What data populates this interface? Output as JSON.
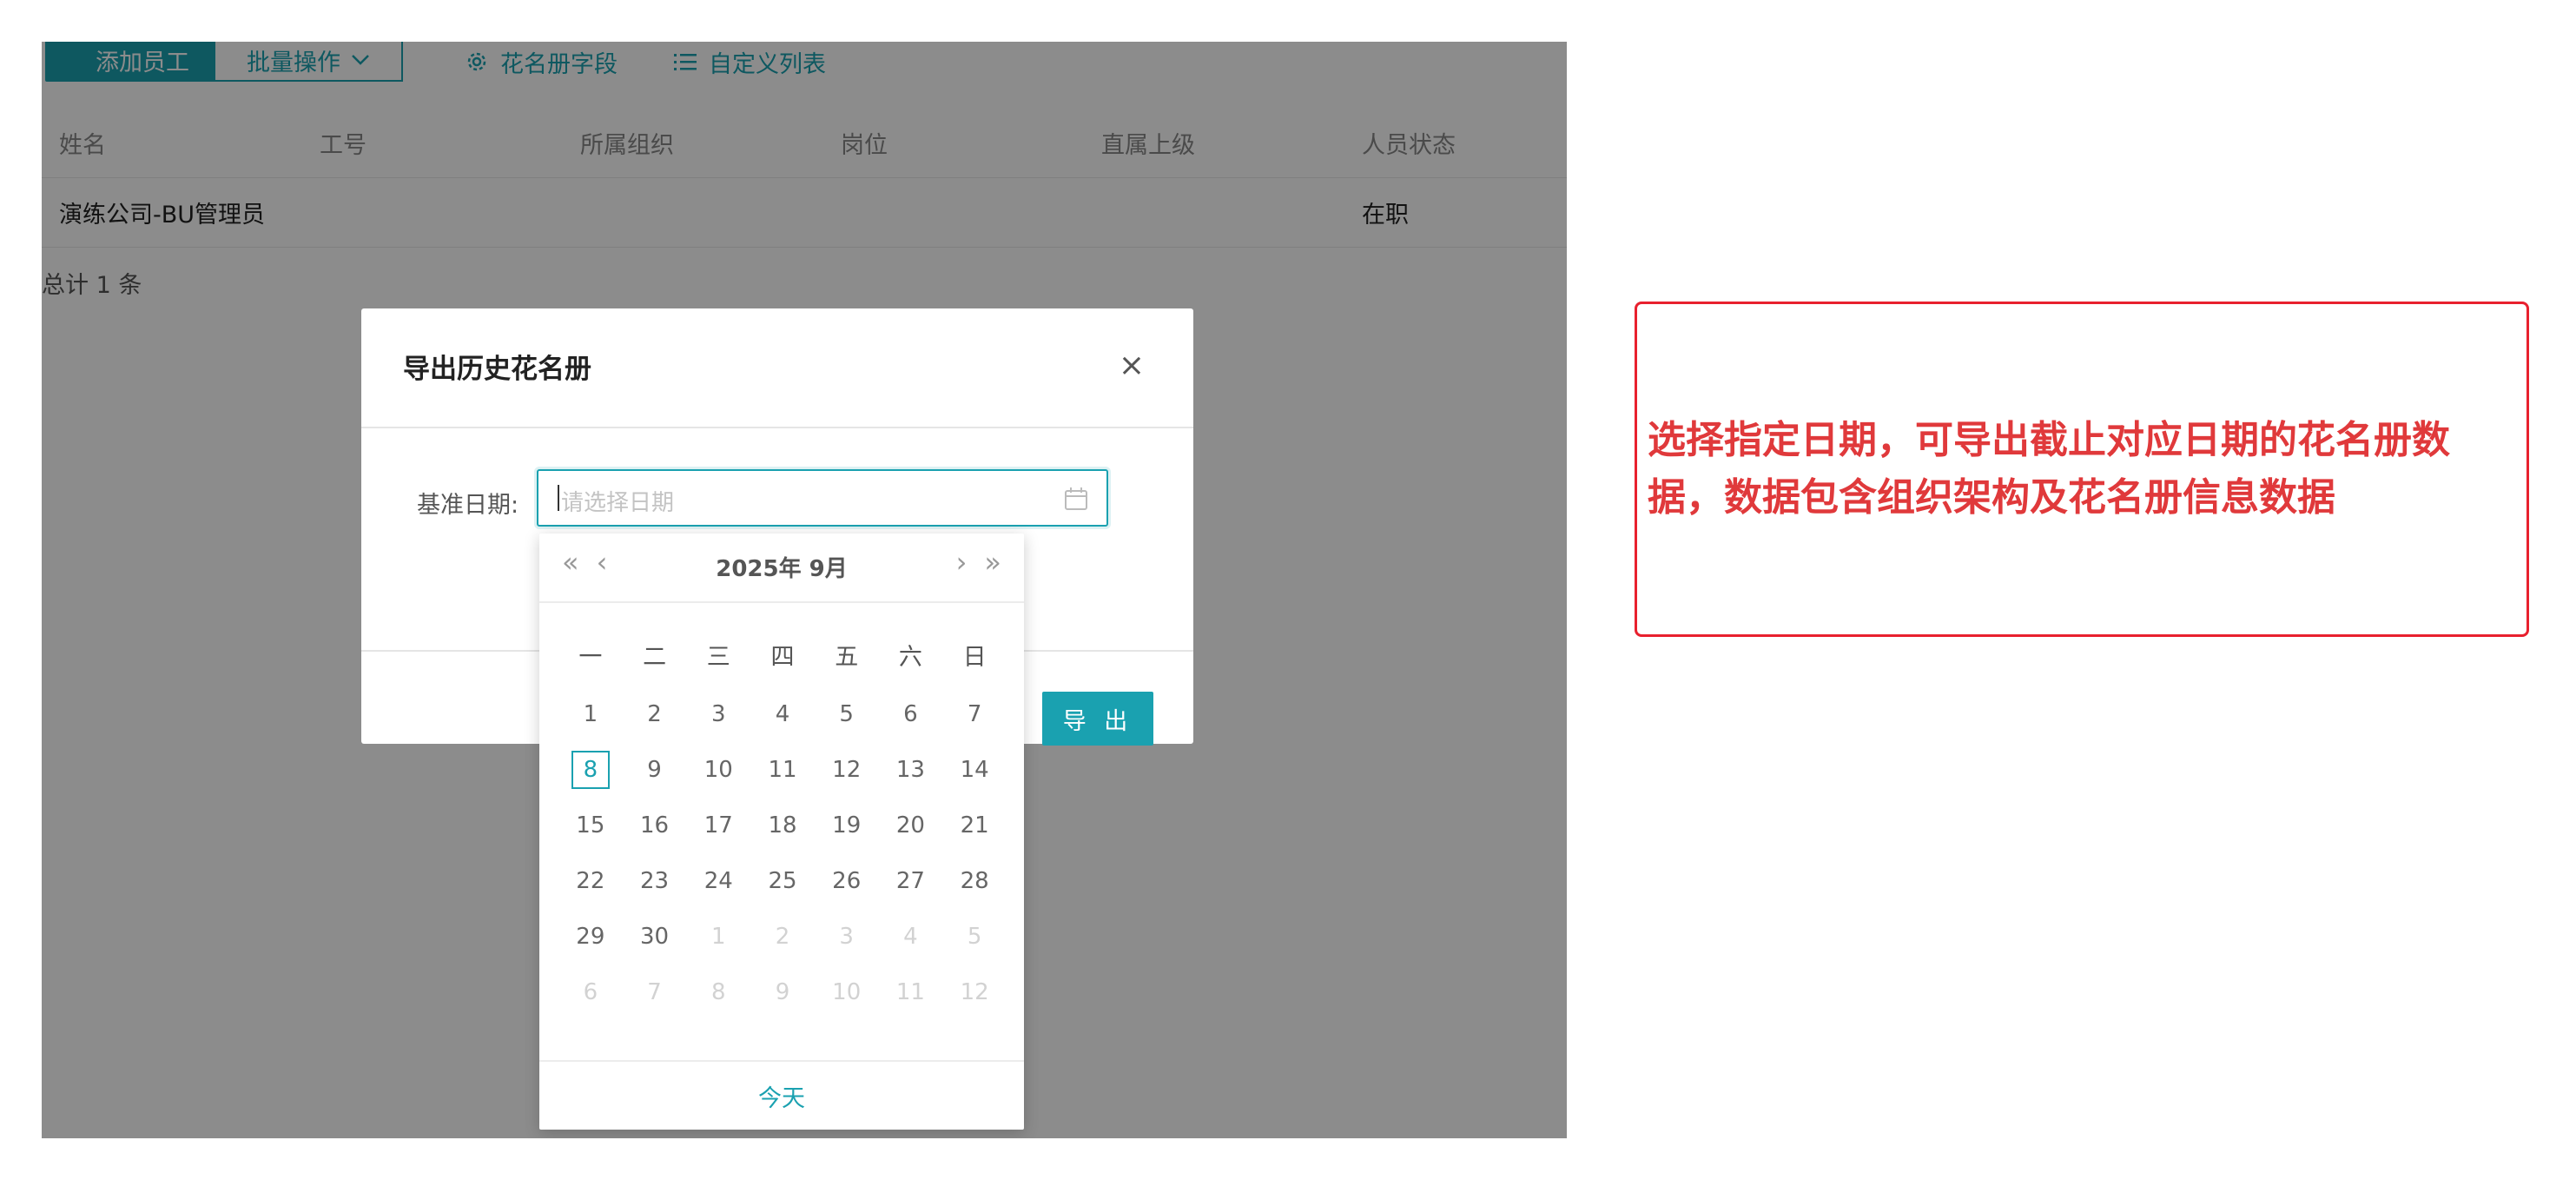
{
  "toolbar": {
    "add_employee": "添加员工",
    "batch_ops": "批量操作",
    "roster_fields": "花名册字段",
    "custom_list": "自定义列表"
  },
  "table": {
    "columns": [
      "姓名",
      "工号",
      "所属组织",
      "岗位",
      "直属上级",
      "人员状态"
    ],
    "rows": [
      {
        "name": "演练公司-BU管理员",
        "id": "",
        "org": "",
        "post": "",
        "manager": "",
        "status": "在职"
      }
    ],
    "total": "总计 1 条"
  },
  "modal": {
    "title": "导出历史花名册",
    "close": "×",
    "label": "基准日期:",
    "placeholder": "请选择日期",
    "export": "导 出"
  },
  "calendar": {
    "title": "2025年  9月",
    "prev_year": "«",
    "prev_month": "‹",
    "next_month": "›",
    "next_year": "»",
    "weekdays": [
      "一",
      "二",
      "三",
      "四",
      "五",
      "六",
      "日"
    ],
    "today_label": "今天",
    "today_day": "8",
    "days": [
      [
        "1",
        "2",
        "3",
        "4",
        "5",
        "6",
        "7"
      ],
      [
        "8",
        "9",
        "10",
        "11",
        "12",
        "13",
        "14"
      ],
      [
        "15",
        "16",
        "17",
        "18",
        "19",
        "20",
        "21"
      ],
      [
        "22",
        "23",
        "24",
        "25",
        "26",
        "27",
        "28"
      ],
      [
        "29",
        "30",
        "1",
        "2",
        "3",
        "4",
        "5"
      ],
      [
        "6",
        "7",
        "8",
        "9",
        "10",
        "11",
        "12"
      ]
    ]
  },
  "annotation": {
    "text": "选择指定日期，可导出截止对应日期的花名册数据，数据包含组织架构及花名册信息数据"
  },
  "icons": {
    "gear": "gear-icon",
    "list": "list-icon",
    "calendar": "calendar-icon",
    "chevron": "chevron-down-icon"
  },
  "colors": {
    "accent": "#1aa1b0",
    "annotation": "#e0393b",
    "annotation_border": "#e8202e"
  }
}
